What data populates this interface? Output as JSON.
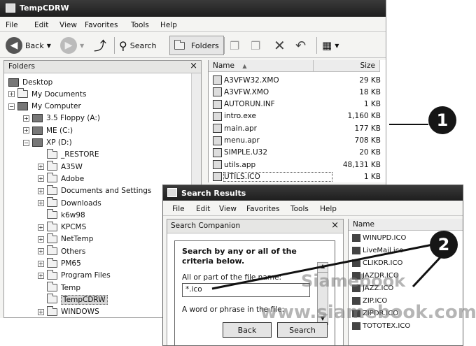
{
  "explorer": {
    "title": "TempCDRW",
    "menu": [
      "File",
      "Edit",
      "View",
      "Favorites",
      "Tools",
      "Help"
    ],
    "toolbar": {
      "back_label": "Back",
      "search_label": "Search",
      "folders_label": "Folders"
    },
    "folders_pane_title": "Folders",
    "tree": [
      {
        "label": "Desktop",
        "expander": "",
        "icon": "desktop"
      },
      {
        "label": "My Documents",
        "expander": "+",
        "icon": "folder"
      },
      {
        "label": "My Computer",
        "expander": "-",
        "icon": "computer"
      },
      {
        "label": "3.5 Floppy (A:)",
        "expander": "+",
        "icon": "drive"
      },
      {
        "label": "ME (C:)",
        "expander": "+",
        "icon": "drive"
      },
      {
        "label": "XP (D:)",
        "expander": "-",
        "icon": "drive"
      },
      {
        "label": "_RESTORE",
        "expander": "",
        "icon": "folder"
      },
      {
        "label": "A35W",
        "expander": "+",
        "icon": "folder"
      },
      {
        "label": "Adobe",
        "expander": "+",
        "icon": "folder"
      },
      {
        "label": "Documents and Settings",
        "expander": "+",
        "icon": "folder"
      },
      {
        "label": "Downloads",
        "expander": "+",
        "icon": "folder"
      },
      {
        "label": "k6w98",
        "expander": "",
        "icon": "folder"
      },
      {
        "label": "KPCMS",
        "expander": "+",
        "icon": "folder"
      },
      {
        "label": "NetTemp",
        "expander": "+",
        "icon": "folder"
      },
      {
        "label": "Others",
        "expander": "+",
        "icon": "folder"
      },
      {
        "label": "PM65",
        "expander": "+",
        "icon": "folder"
      },
      {
        "label": "Program Files",
        "expander": "+",
        "icon": "folder"
      },
      {
        "label": "Temp",
        "expander": "",
        "icon": "folder"
      },
      {
        "label": "TempCDRW",
        "expander": "",
        "icon": "folder"
      },
      {
        "label": "WINDOWS",
        "expander": "+",
        "icon": "folder"
      }
    ],
    "columns": {
      "name": "Name",
      "size": "Size"
    },
    "files": [
      {
        "name": "A3VFW32.XMO",
        "size": "29 KB"
      },
      {
        "name": "A3VFW.XMO",
        "size": "18 KB"
      },
      {
        "name": "AUTORUN.INF",
        "size": "1 KB"
      },
      {
        "name": "intro.exe",
        "size": "1,160 KB"
      },
      {
        "name": "main.apr",
        "size": "177 KB"
      },
      {
        "name": "menu.apr",
        "size": "708 KB"
      },
      {
        "name": "SIMPLE.U32",
        "size": "20 KB"
      },
      {
        "name": "utils.app",
        "size": "48,131 KB"
      },
      {
        "name": "UTILS.ICO",
        "size": "1 KB"
      }
    ]
  },
  "callouts": {
    "one": "1",
    "two": "2"
  },
  "search": {
    "title": "Search Results",
    "menu": [
      "File",
      "Edit",
      "View",
      "Favorites",
      "Tools",
      "Help"
    ],
    "companion_title": "Search Companion",
    "heading": "Search by any or all of the criteria below.",
    "name_label": "All or part of the file name:",
    "name_value": "*.ico",
    "phrase_label": "A word or phrase in the file:",
    "back_button": "Back",
    "search_button": "Search",
    "results_column": "Name",
    "results": [
      "WINUPD.ICO",
      "LiveMail.ico",
      "CLIKDR.ICO",
      "JAZDR.ICO",
      "JAZZ.ICO",
      "ZIP.ICO",
      "ZIPDR.ICO",
      "TOTOTEX.ICO"
    ]
  },
  "watermark": "Siamebook",
  "watermark_url": "www.siamebook.com"
}
